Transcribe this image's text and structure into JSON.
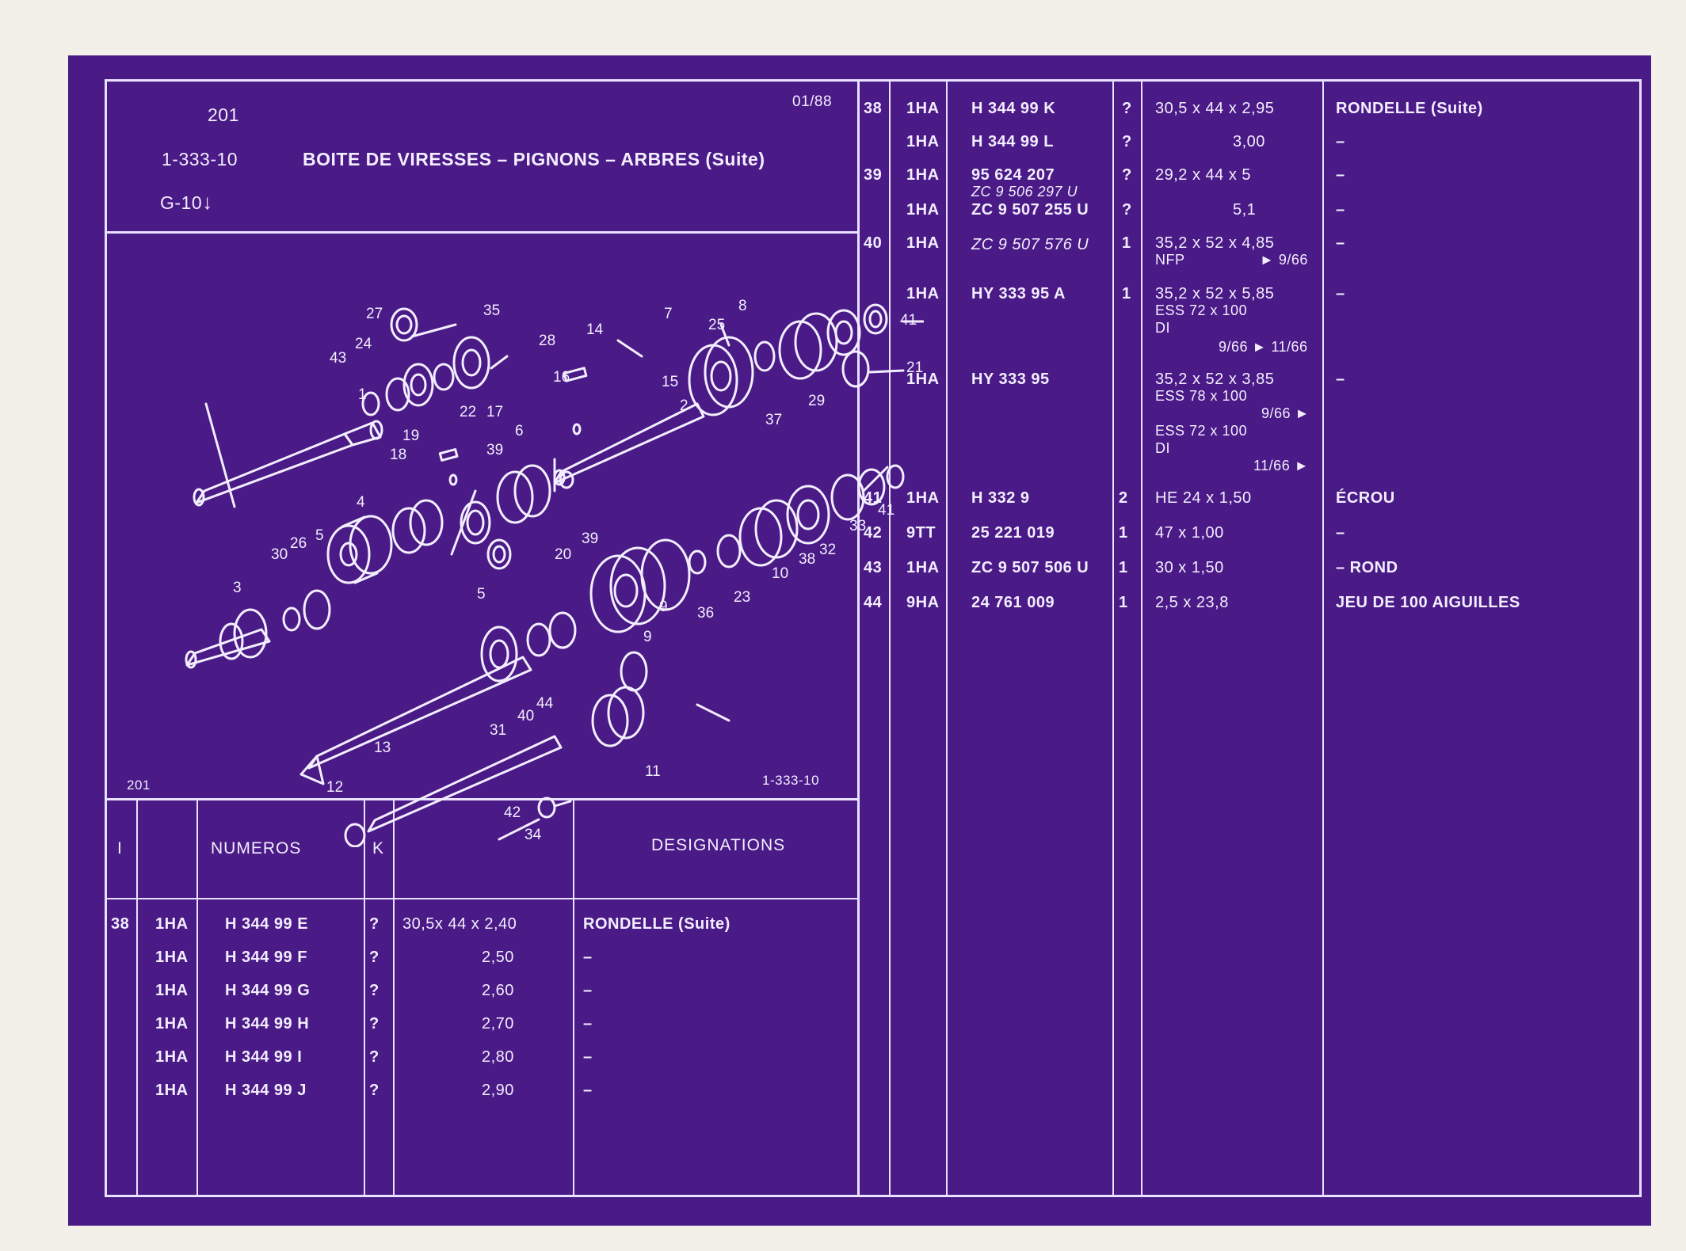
{
  "header": {
    "page_number": "201",
    "date": "01/88",
    "reference": "1-333-10",
    "title": "BOITE DE VIRESSES – PIGNONS – ARBRES (Suite)",
    "model": "G-10",
    "model_arrow": "↓"
  },
  "diagram": {
    "caption_left": "201",
    "caption_right": "1-333-10",
    "callouts": [
      "1",
      "2",
      "3",
      "4",
      "5",
      "5",
      "6",
      "7",
      "8",
      "9",
      "9",
      "10",
      "11",
      "12",
      "13",
      "14",
      "15",
      "16",
      "17",
      "18",
      "19",
      "20",
      "21",
      "22",
      "23",
      "24",
      "25",
      "26",
      "27",
      "28",
      "29",
      "30",
      "31",
      "32",
      "33",
      "34",
      "35",
      "36",
      "37",
      "38",
      "39",
      "39",
      "40",
      "41",
      "41",
      "42",
      "43",
      "44"
    ]
  },
  "columns": {
    "index": "I",
    "numeros": "NUMEROS",
    "k": "K",
    "designations": "DESIGNATIONS"
  },
  "left_rows": [
    {
      "index": "38",
      "prefix": "1HA",
      "number": "H 344  99 E",
      "k": "?",
      "dims": "30,5x 44 x  2,40",
      "designation": "RONDELLE (Suite)"
    },
    {
      "index": "",
      "prefix": "1HA",
      "number": "H 344  99 F",
      "k": "?",
      "dims": "2,50",
      "designation": "–"
    },
    {
      "index": "",
      "prefix": "1HA",
      "number": "H 344  99 G",
      "k": "?",
      "dims": "2,60",
      "designation": "–"
    },
    {
      "index": "",
      "prefix": "1HA",
      "number": "H 344  99 H",
      "k": "?",
      "dims": "2,70",
      "designation": "–"
    },
    {
      "index": "",
      "prefix": "1HA",
      "number": "H 344  99 I",
      "k": "?",
      "dims": "2,80",
      "designation": "–"
    },
    {
      "index": "",
      "prefix": "1HA",
      "number": "H 344  99 J",
      "k": "?",
      "dims": "2,90",
      "designation": "–"
    }
  ],
  "right_rows": [
    {
      "index": "38",
      "prefix": "1HA",
      "number": "H 344  99  K",
      "k": "?",
      "dims": [
        "30,5 x 44 x 2,95"
      ],
      "designation": "RONDELLE (Suite)"
    },
    {
      "index": "",
      "prefix": "1HA",
      "number": "H 344  99  L",
      "k": "?",
      "dims": [
        "3,00"
      ],
      "designation": "–"
    },
    {
      "index": "39",
      "prefix": "1HA",
      "number": "95 624 207",
      "number2": "ZC  9  506  297  U",
      "k": "?",
      "dims": [
        "29,2 x 44 x 5"
      ],
      "designation": "–"
    },
    {
      "index": "",
      "prefix": "1HA",
      "number": "ZC  9  507  255  U",
      "k": "?",
      "dims": [
        "5,1"
      ],
      "designation": "–"
    },
    {
      "index": "40",
      "prefix": "1HA",
      "number": "ZC  9  507  576  U",
      "k": "1",
      "dims": [
        "35,2 x 52 x 4,85",
        "NFP",
        "► 9/66"
      ],
      "designation": "–"
    },
    {
      "index": "",
      "prefix": "1HA",
      "number": "HY  333   95  A",
      "k": "1",
      "dims": [
        "35,2 x 52 x 5,85",
        "ESS 72 x 100",
        "DI",
        "9/66  ► 11/66"
      ],
      "designation": "–"
    },
    {
      "index": "",
      "prefix": "1HA",
      "number": "HY  333   95",
      "k": "",
      "dims": [
        "35,2 x 52 x 3,85",
        "ESS 78 x 100",
        "9/66 ►",
        "ESS 72 x 100",
        "DI",
        "11/66 ►"
      ],
      "designation": "–"
    },
    {
      "index": "41",
      "prefix": "1HA",
      "number": "H  332    9",
      "k": "2",
      "dims": [
        "HE 24 x 1,50"
      ],
      "designation": "ÉCROU"
    },
    {
      "index": "42",
      "prefix": "9TT",
      "number": "25  221  019",
      "k": "1",
      "dims": [
        "47 x 1,00"
      ],
      "designation": "–"
    },
    {
      "index": "43",
      "prefix": "1HA",
      "number": "ZC  9  507  506  U",
      "k": "1",
      "dims": [
        "30 x 1,50"
      ],
      "designation": "– ROND"
    },
    {
      "index": "44",
      "prefix": "9HA",
      "number": "24  761  009",
      "k": "1",
      "dims": [
        "2,5 x 23,8"
      ],
      "designation": "JEU DE 100 AIGUILLES"
    }
  ]
}
